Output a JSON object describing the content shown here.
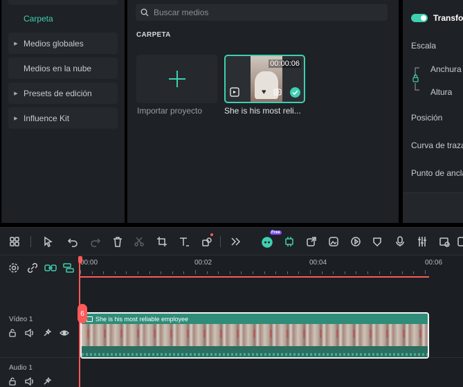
{
  "sidebar": {
    "active_label": "Carpeta",
    "items": [
      {
        "label": "Medios globales",
        "arrow": true
      },
      {
        "label": "Medios en la nube",
        "arrow": false
      },
      {
        "label": "Presets de edición",
        "arrow": true
      },
      {
        "label": "Influence Kit",
        "arrow": true
      }
    ]
  },
  "media": {
    "search_placeholder": "Buscar medios",
    "section_label": "CARPETA",
    "import_label": "Importar proyecto",
    "clip": {
      "duration": "00:00:06",
      "name": "She is his most reli..."
    }
  },
  "properties": {
    "toggle_label": "Transfor",
    "scale_label": "Escala",
    "width_label": "Anchura",
    "height_label": "Altura",
    "position_label": "Posición",
    "trace_label": "Curva de traza",
    "anchor_label": "Punto de ancla"
  },
  "timeline": {
    "free_badge": "Free",
    "ruler": [
      "00:00",
      "00:02",
      "00:04",
      "00:06"
    ],
    "tracks": {
      "video": "Vídeo 1",
      "audio": "Audio 1"
    },
    "clip_title": "She is his most reliable employee",
    "accent": "#3fd0b1",
    "playhead_color": "#ff5a5a"
  }
}
